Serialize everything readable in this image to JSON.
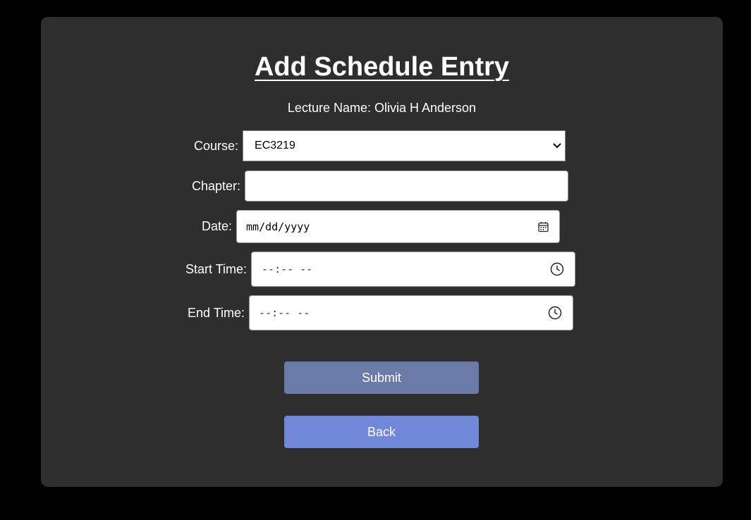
{
  "form": {
    "title": "Add Schedule Entry",
    "lecture_label": "Lecture Name: Olivia H Anderson",
    "course_label": "Course:",
    "course_value": "EC3219",
    "chapter_label": "Chapter:",
    "chapter_value": "",
    "date_label": "Date:",
    "date_placeholder": "mm/dd/yyyy",
    "start_label": "Start Time:",
    "start_placeholder": "--:-- --",
    "end_label": "End Time:",
    "end_placeholder": "--:-- --",
    "submit_label": "Submit",
    "back_label": "Back"
  },
  "icons": {
    "course": "chevron-down-icon",
    "date": "calendar-icon",
    "start": "clock-icon",
    "end": "clock-icon"
  },
  "colors": {
    "page_background": "#000000",
    "card_background": "#2e2e2e",
    "submit_button": "#6b7ba8",
    "back_button": "#7188d8",
    "text": "#ffffff"
  }
}
